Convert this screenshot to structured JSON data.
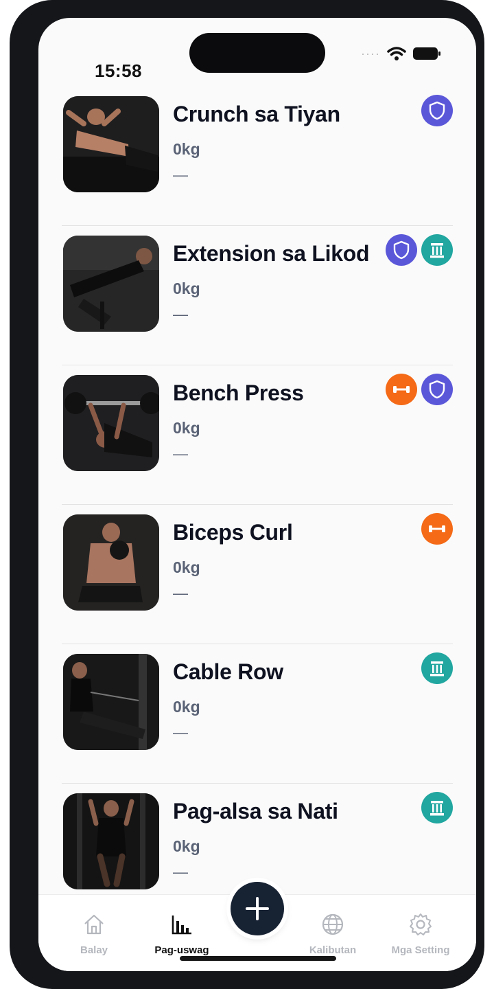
{
  "status_bar": {
    "time": "15:58",
    "dots": "····"
  },
  "exercises": [
    {
      "name": "Crunch sa Tiyan",
      "weight": "0kg",
      "detail": "—",
      "badges": [
        "shield"
      ]
    },
    {
      "name": "Extension sa Likod",
      "weight": "0kg",
      "detail": "—",
      "badges": [
        "shield",
        "pillar"
      ]
    },
    {
      "name": "Bench Press",
      "weight": "0kg",
      "detail": "—",
      "badges": [
        "dumbbell",
        "shield"
      ]
    },
    {
      "name": "Biceps Curl",
      "weight": "0kg",
      "detail": "—",
      "badges": [
        "dumbbell"
      ]
    },
    {
      "name": "Cable Row",
      "weight": "0kg",
      "detail": "—",
      "badges": [
        "pillar"
      ]
    },
    {
      "name": "Pag-alsa sa Nati",
      "weight": "0kg",
      "detail": "—",
      "badges": [
        "pillar"
      ]
    }
  ],
  "badge_colors": {
    "shield": "#5b57d9",
    "pillar": "#21a6a0",
    "dumbbell": "#f46a17"
  },
  "tab_bar": {
    "tabs": [
      {
        "label": "Balay",
        "icon": "house-icon",
        "active": false
      },
      {
        "label": "Pag-uswag",
        "icon": "bar-chart-icon",
        "active": true
      },
      {
        "label": "Kalibutan",
        "icon": "globe-icon",
        "active": false
      },
      {
        "label": "Mga Setting",
        "icon": "gear-icon",
        "active": false
      }
    ],
    "fab_icon": "plus-icon"
  }
}
